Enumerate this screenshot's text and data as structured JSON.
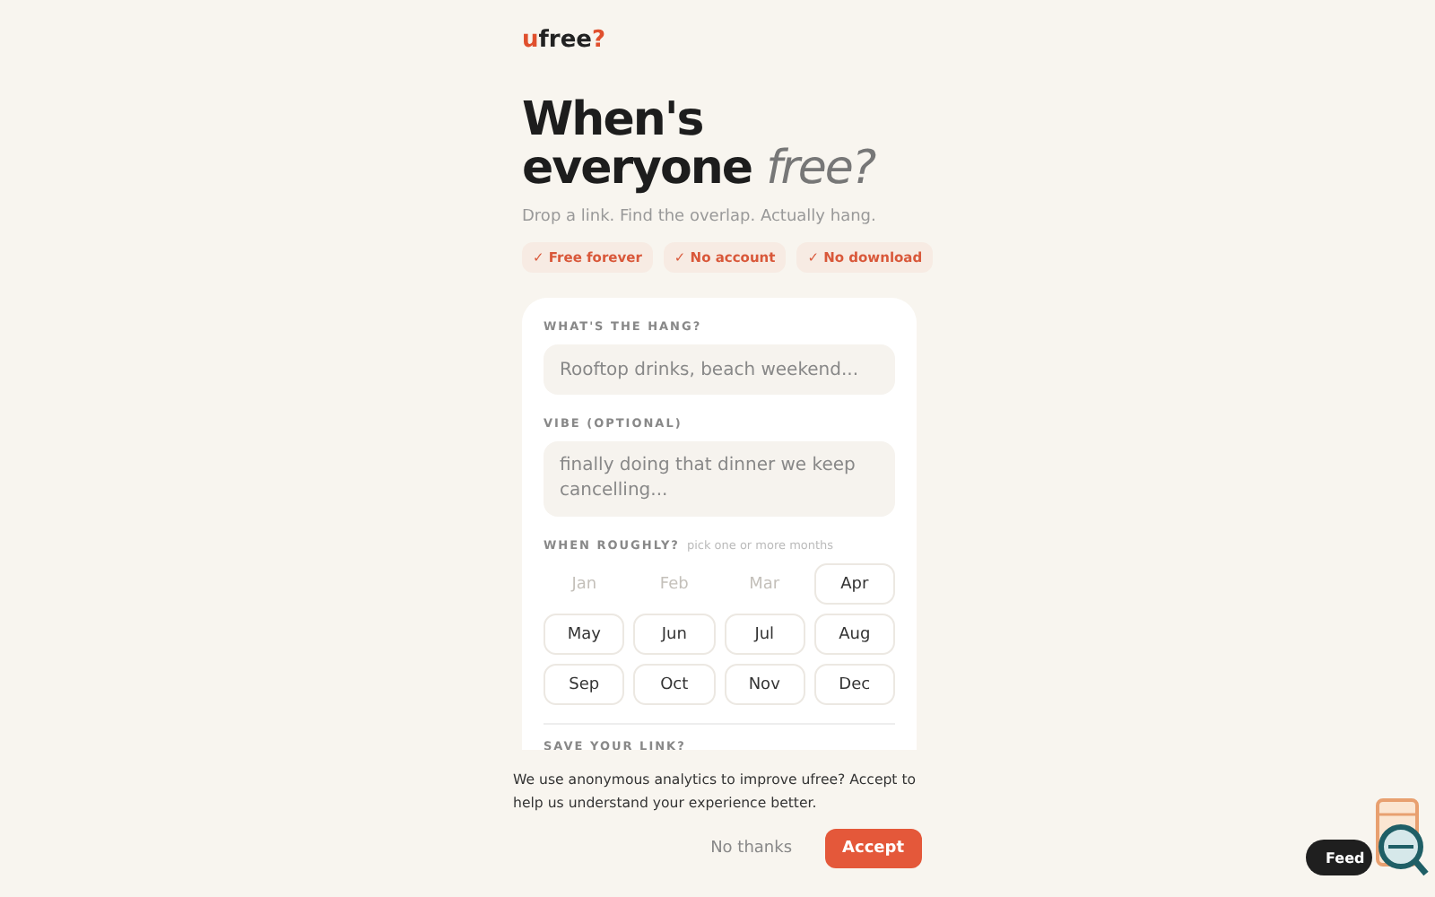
{
  "logo": {
    "first": "u",
    "middle": "free",
    "last": "?"
  },
  "headline": {
    "line1": "When's",
    "line2": "everyone",
    "accent": "free?"
  },
  "tagline": "Drop a link. Find the overlap. Actually hang.",
  "badges": [
    "✓ Free forever",
    "✓ No account",
    "✓ No download"
  ],
  "form": {
    "hang_label": "WHAT'S THE HANG?",
    "hang_placeholder": "Rooftop drinks, beach weekend...",
    "vibe_label": "VIBE (OPTIONAL)",
    "vibe_placeholder": "finally doing that dinner we keep cancelling...",
    "when_label": "WHEN ROUGHLY?",
    "when_hint": "pick one or more months",
    "months": [
      {
        "label": "Jan",
        "disabled": true
      },
      {
        "label": "Feb",
        "disabled": true
      },
      {
        "label": "Mar",
        "disabled": true
      },
      {
        "label": "Apr",
        "disabled": false
      },
      {
        "label": "May",
        "disabled": false
      },
      {
        "label": "Jun",
        "disabled": false
      },
      {
        "label": "Jul",
        "disabled": false
      },
      {
        "label": "Aug",
        "disabled": false
      },
      {
        "label": "Sep",
        "disabled": false
      },
      {
        "label": "Oct",
        "disabled": false
      },
      {
        "label": "Nov",
        "disabled": false
      },
      {
        "label": "Dec",
        "disabled": false
      }
    ],
    "save_label": "SAVE YOUR LINK?"
  },
  "cookie": {
    "text": "We use anonymous analytics to improve ufree? Accept to help us understand your experience better.",
    "decline": "No thanks",
    "accept": "Accept"
  },
  "feedback": {
    "label": "Feed"
  }
}
